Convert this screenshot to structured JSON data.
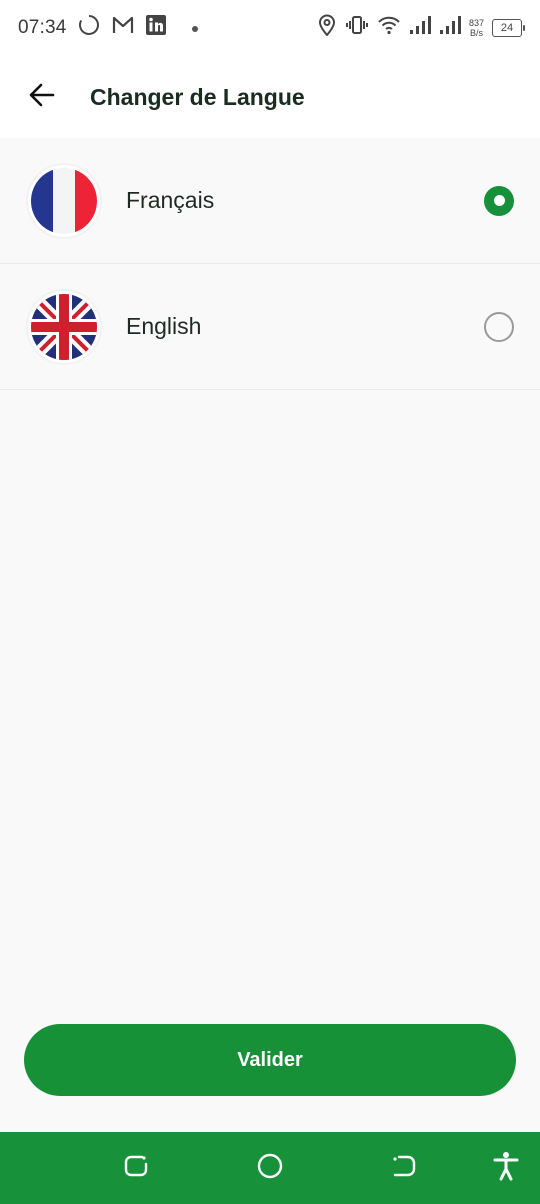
{
  "status_bar": {
    "time": "07:34",
    "net_speed_value": "837",
    "net_speed_unit": "B/s",
    "battery_level": "24",
    "icons": [
      "loading-circle-icon",
      "gmail-icon",
      "linkedin-icon",
      "dot-icon",
      "location-icon",
      "vibrate-icon",
      "wifi-icon",
      "signal-icon",
      "signal-icon-2",
      "battery-icon"
    ]
  },
  "app_bar": {
    "title": "Changer de Langue",
    "back_icon": "arrow-left-icon"
  },
  "languages": [
    {
      "label": "Français",
      "flag": "france-flag-icon",
      "selected": true
    },
    {
      "label": "English",
      "flag": "uk-flag-icon",
      "selected": false
    }
  ],
  "validate_label": "Valider",
  "colors": {
    "accent": "#179138",
    "background": "#f9f9f9",
    "radio_unselected": "#9a9a9a"
  },
  "nav_bar": {
    "icons": [
      "recent-apps-icon",
      "home-icon",
      "back-nav-icon",
      "accessibility-icon"
    ]
  }
}
